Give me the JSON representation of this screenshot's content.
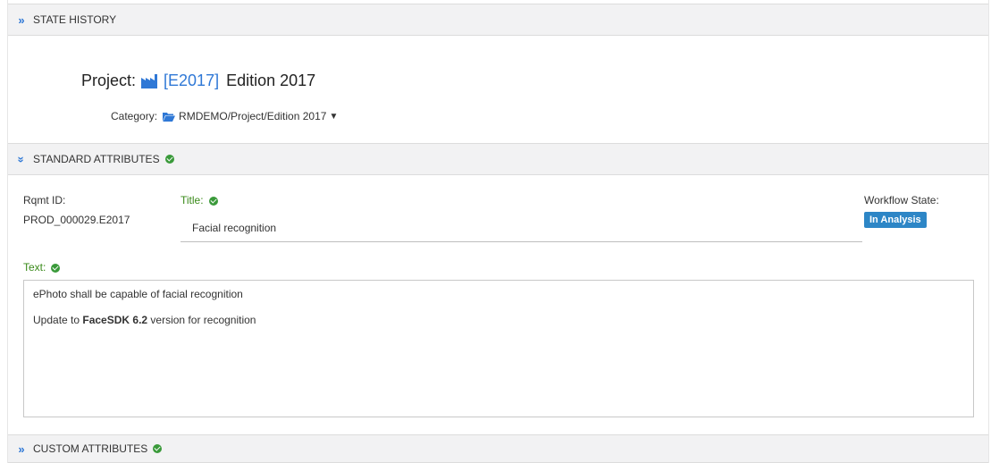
{
  "sections": {
    "state_history": {
      "label": "STATE HISTORY",
      "icon": "double-chevron-right-icon"
    },
    "standard_attributes": {
      "label": "STANDARD ATTRIBUTES",
      "icon": "double-chevron-down-icon",
      "valid": true
    },
    "custom_attributes": {
      "label": "CUSTOM ATTRIBUTES",
      "icon": "double-chevron-right-icon",
      "valid": true
    }
  },
  "project": {
    "prefix": "Project:",
    "icon": "factory-icon",
    "code": "[E2017]",
    "name": "Edition 2017"
  },
  "category": {
    "label": "Category:",
    "icon": "folder-open-icon",
    "path": "RMDEMO/Project/Edition 2017"
  },
  "fields": {
    "rqmt_id_label": "Rqmt ID:",
    "rqmt_id_value": "PROD_000029.E2017",
    "title_label": "Title:",
    "title_value": "Facial recognition",
    "workflow_label": "Workflow State:",
    "workflow_value": "In Analysis",
    "text_label": "Text:"
  },
  "text_content": {
    "line1": "ePhoto shall be capable of facial recognition",
    "line2_prefix": "Update to ",
    "line2_bold": "FaceSDK 6.2",
    "line2_suffix": " version for recognition"
  },
  "colors": {
    "accent": "#2f78d6",
    "valid_green": "#3a9a3a",
    "badge_blue": "#2d86c6",
    "section_bg": "#f2f2f3"
  }
}
